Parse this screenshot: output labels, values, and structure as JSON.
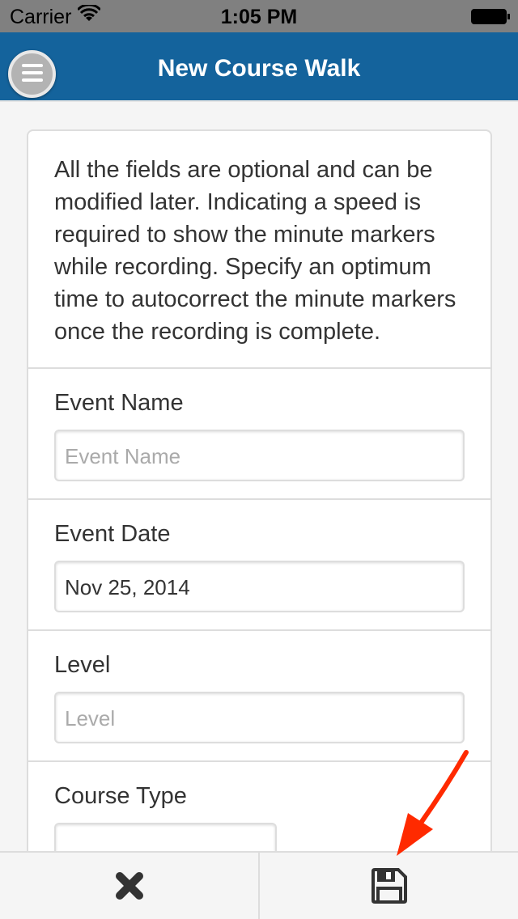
{
  "status_bar": {
    "carrier": "Carrier",
    "time": "1:05 PM"
  },
  "header": {
    "title": "New Course Walk"
  },
  "intro": "All the fields are optional and can be modified later. Indicating a speed is required to show the minute markers while recording. Specify an optimum time to autocorrect the minute markers once the recording is complete.",
  "fields": [
    {
      "label": "Event Name",
      "value": "",
      "placeholder": "Event Name"
    },
    {
      "label": "Event Date",
      "value": "Nov 25, 2014",
      "placeholder": ""
    },
    {
      "label": "Level",
      "value": "",
      "placeholder": "Level"
    },
    {
      "label": "Course Type",
      "value": "",
      "placeholder": ""
    }
  ],
  "footer": {
    "cancel_icon": "close-icon",
    "save_icon": "floppy-disk-icon"
  },
  "annotation_color": "#ff2a00"
}
